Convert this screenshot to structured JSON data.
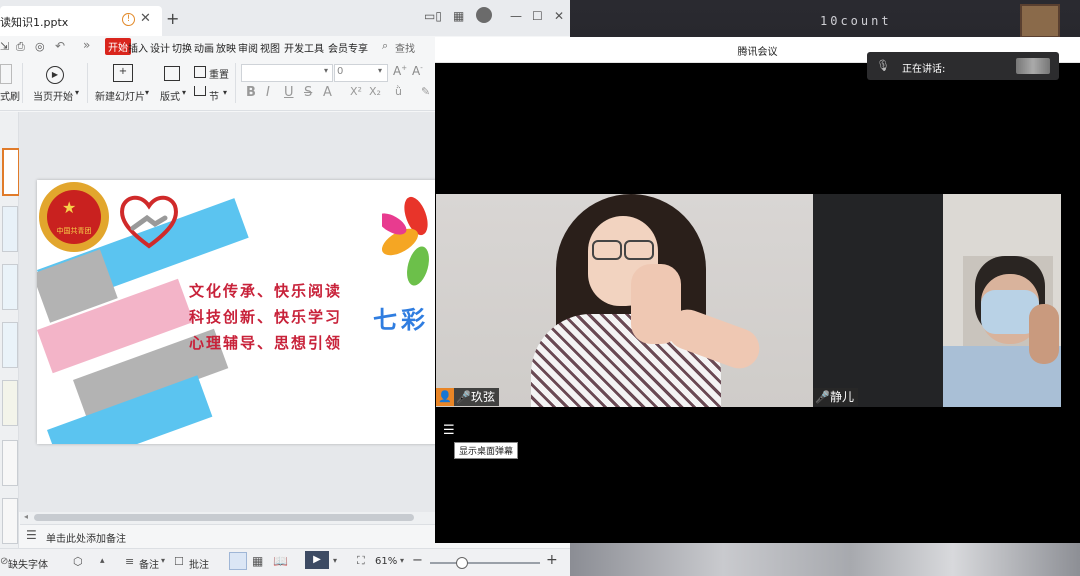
{
  "wps": {
    "doc_tab": "读知识1.pptx",
    "menu": [
      "开始",
      "插入",
      "设计",
      "切换",
      "动画",
      "放映",
      "审阅",
      "视图",
      "开发工具",
      "会员专享"
    ],
    "search": "查找",
    "ribbon": {
      "format_brush": "式刷",
      "from_current": "当页开始",
      "new_slide": "新建幻灯片",
      "layout": "版式",
      "reset": "重置",
      "section": "节",
      "font_size": "0"
    },
    "notes_placeholder": "单击此处添加备注",
    "status": {
      "missing_font": "缺失字体",
      "notes": "备注",
      "comment": "批注",
      "zoom": "61%"
    }
  },
  "slide": {
    "slogans": [
      "文化传承、快乐阅读",
      "科技创新、快乐学习",
      "心理辅导、思想引领"
    ],
    "side_title": "七彩",
    "badge_text": "中国共青团"
  },
  "desktop": {
    "bg_text": "10count"
  },
  "meeting": {
    "title": "腾讯会议",
    "speaking": "正在讲话:",
    "participants": [
      "玖弦",
      "静儿"
    ],
    "danmu_tooltip": "显示桌面弹幕"
  },
  "colors": {
    "wps_accent": "#d9251d",
    "stripe_blue": "#5bc4f0",
    "stripe_pink": "#f3b4c8",
    "stripe_gray": "#b3b3b3",
    "slogan_red": "#c8223a"
  }
}
